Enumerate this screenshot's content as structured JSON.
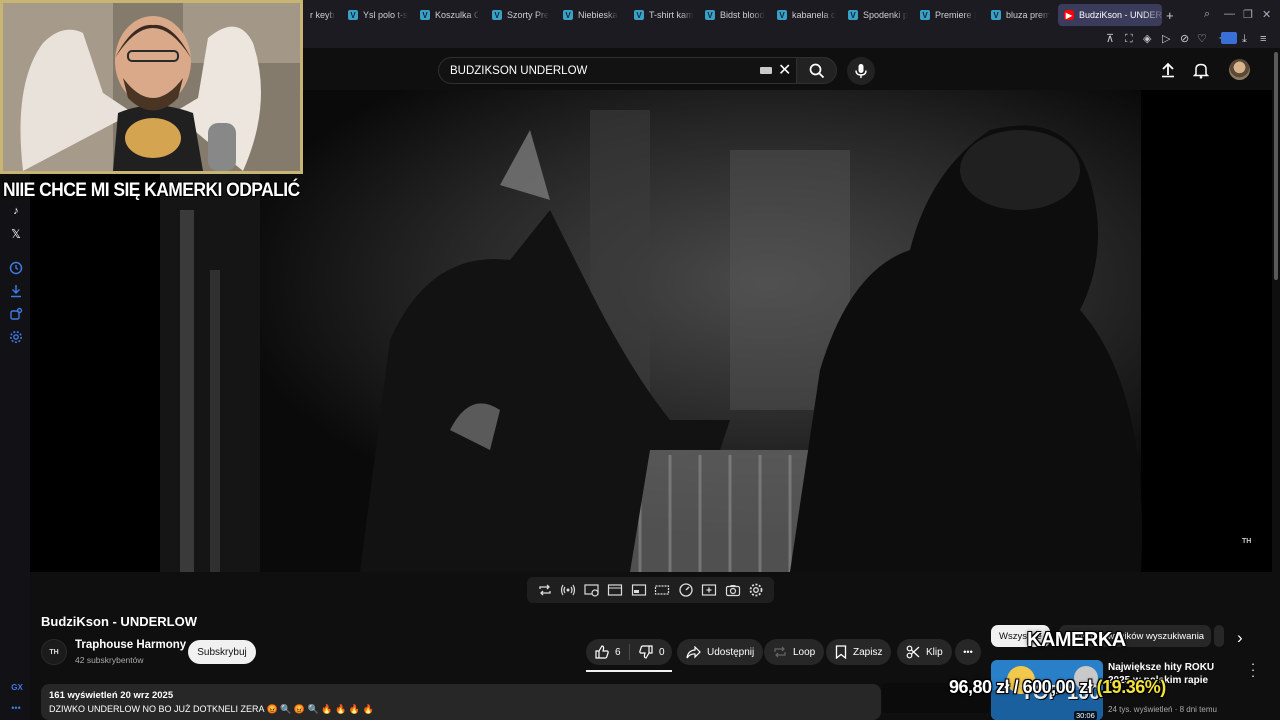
{
  "browser": {
    "tabs": [
      {
        "label": "r keyb",
        "favicon": "none"
      },
      {
        "label": "Ysl polo t-s",
        "favicon": "V"
      },
      {
        "label": "Koszulka C",
        "favicon": "V"
      },
      {
        "label": "Szorty Pre",
        "favicon": "V"
      },
      {
        "label": "Niebieska",
        "favicon": "V"
      },
      {
        "label": "T-shirt kam",
        "favicon": "V"
      },
      {
        "label": "Bidst blood",
        "favicon": "V"
      },
      {
        "label": "kabanela c",
        "favicon": "V"
      },
      {
        "label": "Spodenki p",
        "favicon": "V"
      },
      {
        "label": "Premiere |",
        "favicon": "V"
      },
      {
        "label": "bluza prem",
        "favicon": "V"
      }
    ],
    "active_tab": {
      "label": "BudziKson - UNDERL",
      "favicon": "youtube-icon"
    },
    "new_tab": "+"
  },
  "header": {
    "search_value": "BUDZIKSON UNDERLOW"
  },
  "overlay": {
    "caption": "NIIE CHCE MI SIĘ KAMERKI ODPALIĆ",
    "kamerka_label": "KAMERKA",
    "ticker_prefix": "96,80 zł",
    "ticker_mid": "/",
    "ticker_amount": "600,00 zł",
    "ticker_pct": "(19.36%)"
  },
  "video": {
    "title": "BudziKson - UNDERLOW",
    "watermark": "TH",
    "channel": {
      "avatar_text": "TH",
      "name": "Traphouse Harmony",
      "subs": "42 subskrybentów"
    },
    "subscribe_label": "Subskrybuj",
    "likes": "6",
    "dislikes": "0",
    "share_label": "Udostępnij",
    "loop_label": "Loop",
    "save_label": "Zapisz",
    "clip_label": "Klip",
    "more_label": "•••",
    "desc_stats": "161 wyświetleń  20 wrz 2025",
    "desc_text": "DZIWKO UNDERLOW NO BO JUŻ DOTKNELI ZERA"
  },
  "sidebar_right": {
    "chips": [
      "Wszystkie",
      "Z Twoich wyników wyszukiwania"
    ],
    "next_arrow": "›",
    "rec": {
      "title": "Największe hity ROKU 2025 w polskim rapie",
      "meta": "24 tys. wyświetleń · 8 dni temu",
      "duration": "30:06",
      "thumb_text": "TOP 100"
    }
  },
  "left_rail": {
    "bottom_label": "GX",
    "dots": "•••"
  },
  "colors": {
    "tab_active": "#3b3b5c",
    "favicon_v": "#3aa0c8",
    "webcam_border": "#c8b574",
    "ticker_highlight": "#f2e23a",
    "rail_icon": "#3d7be0"
  }
}
